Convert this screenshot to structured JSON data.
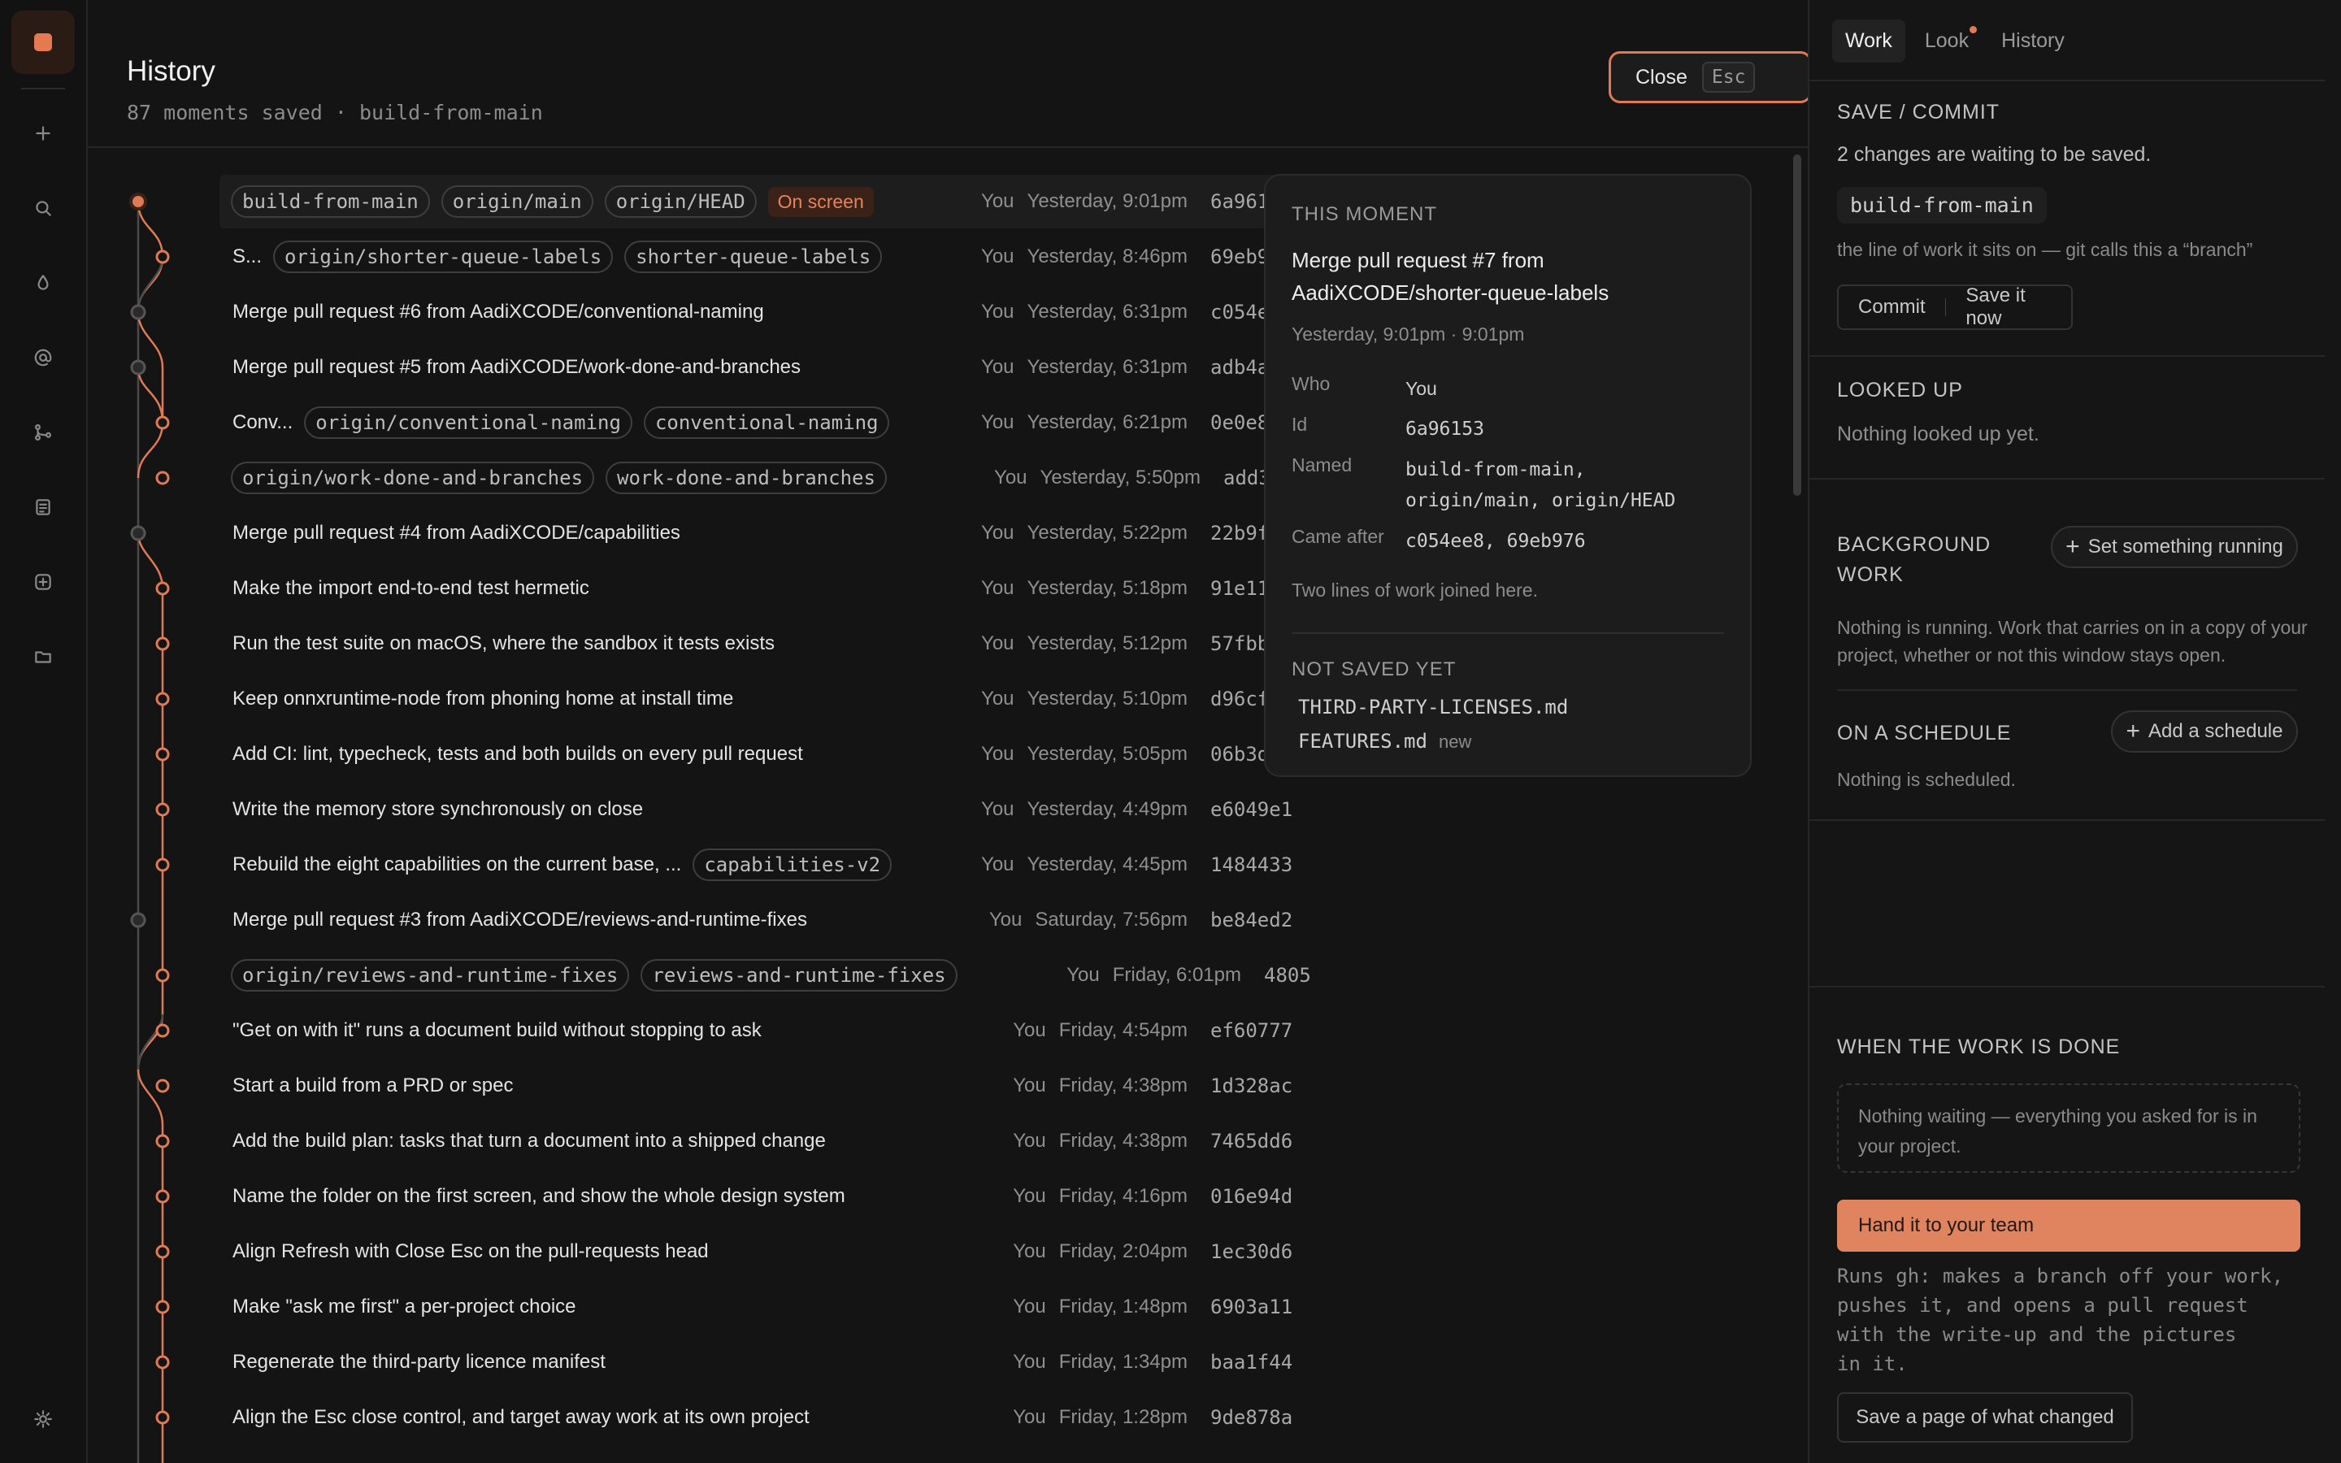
{
  "rail": {
    "icons": [
      "app-logo",
      "plus-icon",
      "search-icon",
      "drop-icon",
      "at-icon",
      "branch-icon",
      "notes-icon",
      "add-box-icon",
      "folder-icon",
      "settings-icon"
    ]
  },
  "header": {
    "title": "History",
    "subtitle": "87 moments saved · build-from-main",
    "close_label": "Close",
    "close_key": "Esc"
  },
  "commits": [
    {
      "msg": "",
      "chips": [
        "build-from-main",
        "origin/main",
        "origin/HEAD"
      ],
      "onscreen": "On screen",
      "who": "You",
      "when": "Yesterday, 9:01pm",
      "hash": "6a96153"
    },
    {
      "msg": "S...",
      "chips": [
        "origin/shorter-queue-labels",
        "shorter-queue-labels"
      ],
      "who": "You",
      "when": "Yesterday, 8:46pm",
      "hash": "69eb976"
    },
    {
      "msg": "Merge pull request #6 from AadiXCODE/conventional-naming",
      "chips": [],
      "who": "You",
      "when": "Yesterday, 6:31pm",
      "hash": "c054ee8"
    },
    {
      "msg": "Merge pull request #5 from AadiXCODE/work-done-and-branches",
      "chips": [],
      "who": "You",
      "when": "Yesterday, 6:31pm",
      "hash": "adb4aa1"
    },
    {
      "msg": "Conv...",
      "chips": [
        "origin/conventional-naming",
        "conventional-naming"
      ],
      "who": "You",
      "when": "Yesterday, 6:21pm",
      "hash": "0e0e890"
    },
    {
      "msg": "",
      "chips": [
        "origin/work-done-and-branches",
        "work-done-and-branches"
      ],
      "who": "You",
      "when": "Yesterday, 5:50pm",
      "hash": "add3ba2"
    },
    {
      "msg": "Merge pull request #4 from AadiXCODE/capabilities",
      "chips": [],
      "who": "You",
      "when": "Yesterday, 5:22pm",
      "hash": "22b9fe6"
    },
    {
      "msg": "Make the import end-to-end test hermetic",
      "chips": [],
      "who": "You",
      "when": "Yesterday, 5:18pm",
      "hash": "91e11a1"
    },
    {
      "msg": "Run the test suite on macOS, where the sandbox it tests exists",
      "chips": [],
      "who": "You",
      "when": "Yesterday, 5:12pm",
      "hash": "57fbb29"
    },
    {
      "msg": "Keep onnxruntime-node from phoning home at install time",
      "chips": [],
      "who": "You",
      "when": "Yesterday, 5:10pm",
      "hash": "d96cf7a"
    },
    {
      "msg": "Add CI: lint, typecheck, tests and both builds on every pull request",
      "chips": [],
      "who": "You",
      "when": "Yesterday, 5:05pm",
      "hash": "06b3d0c"
    },
    {
      "msg": "Write the memory store synchronously on close",
      "chips": [],
      "who": "You",
      "when": "Yesterday, 4:49pm",
      "hash": "e6049e1"
    },
    {
      "msg": "Rebuild the eight capabilities on the current base, ...",
      "chips": [
        "capabilities-v2"
      ],
      "who": "You",
      "when": "Yesterday, 4:45pm",
      "hash": "1484433"
    },
    {
      "msg": "Merge pull request #3 from AadiXCODE/reviews-and-runtime-fixes",
      "chips": [],
      "who": "You",
      "when": "Saturday, 7:56pm",
      "hash": "be84ed2"
    },
    {
      "msg": "",
      "chips": [
        "origin/reviews-and-runtime-fixes",
        "reviews-and-runtime-fixes"
      ],
      "who": "You",
      "when": "Friday, 6:01pm",
      "hash": "4805"
    },
    {
      "msg": "\"Get on with it\" runs a document build without stopping to ask",
      "chips": [],
      "who": "You",
      "when": "Friday, 4:54pm",
      "hash": "ef60777"
    },
    {
      "msg": "Start a build from a PRD or spec",
      "chips": [],
      "who": "You",
      "when": "Friday, 4:38pm",
      "hash": "1d328ac"
    },
    {
      "msg": "Add the build plan: tasks that turn a document into a shipped change",
      "chips": [],
      "who": "You",
      "when": "Friday, 4:38pm",
      "hash": "7465dd6"
    },
    {
      "msg": "Name the folder on the first screen, and show the whole design system",
      "chips": [],
      "who": "You",
      "when": "Friday, 4:16pm",
      "hash": "016e94d"
    },
    {
      "msg": "Align Refresh with Close Esc on the pull-requests head",
      "chips": [],
      "who": "You",
      "when": "Friday, 2:04pm",
      "hash": "1ec30d6"
    },
    {
      "msg": "Make \"ask me first\" a per-project choice",
      "chips": [],
      "who": "You",
      "when": "Friday, 1:48pm",
      "hash": "6903a11"
    },
    {
      "msg": "Regenerate the third-party licence manifest",
      "chips": [],
      "who": "You",
      "when": "Friday, 1:34pm",
      "hash": "baa1f44"
    },
    {
      "msg": "Align the Esc close control, and target away work at its own project",
      "chips": [],
      "who": "You",
      "when": "Friday, 1:28pm",
      "hash": "9de878a"
    }
  ],
  "detail": {
    "label": "THIS MOMENT",
    "title": "Merge pull request #7 from AadiXCODE/shorter-queue-labels",
    "time": "Yesterday, 9:01pm · 9:01pm",
    "who_k": "Who",
    "who_v": "You",
    "id_k": "Id",
    "id_v": "6a96153",
    "named_k": "Named",
    "named_v": "build-from-main, origin/main, origin/HEAD",
    "after_k": "Came after",
    "after_v": "c054ee8, 69eb976",
    "note": "Two lines of work joined here.",
    "unsaved_label": "NOT SAVED YET",
    "file1": "THIRD-PARTY-LICENSES.md",
    "file2": "FEATURES.md",
    "file2_tag": "new"
  },
  "side": {
    "tabs": [
      "Work",
      "Look",
      "History"
    ],
    "save_h": "SAVE / COMMIT",
    "save_t": "2 changes are waiting to be saved.",
    "branch": "build-from-main",
    "branch_note": "the line of work it sits on — git calls this a “branch”",
    "commit_btn": "Commit",
    "save_now_btn": "Save it now",
    "looked_h": "LOOKED UP",
    "looked_t": "Nothing looked up yet.",
    "bg_h1": "BACKGROUND",
    "bg_h2": "WORK",
    "bg_btn": "Set something running",
    "bg_t": "Nothing is running. Work that carries on in a copy of your project, whether or not this window stays open.",
    "sched_h": "ON A SCHEDULE",
    "sched_btn": "Add a schedule",
    "sched_t": "Nothing is scheduled.",
    "done_h": "WHEN THE WORK IS DONE",
    "waiting": "Nothing waiting — everything you asked for is in your project.",
    "hand": "Hand it to your team",
    "runs": "Runs gh: makes a branch off your work,\npushes it, and opens a pull request\nwith the write-up and the pictures\nin it.",
    "save_page": "Save a page of what changed"
  },
  "colors": {
    "accent": "#e57a52",
    "bg": "#141414",
    "panel": "#1c1c1c"
  }
}
